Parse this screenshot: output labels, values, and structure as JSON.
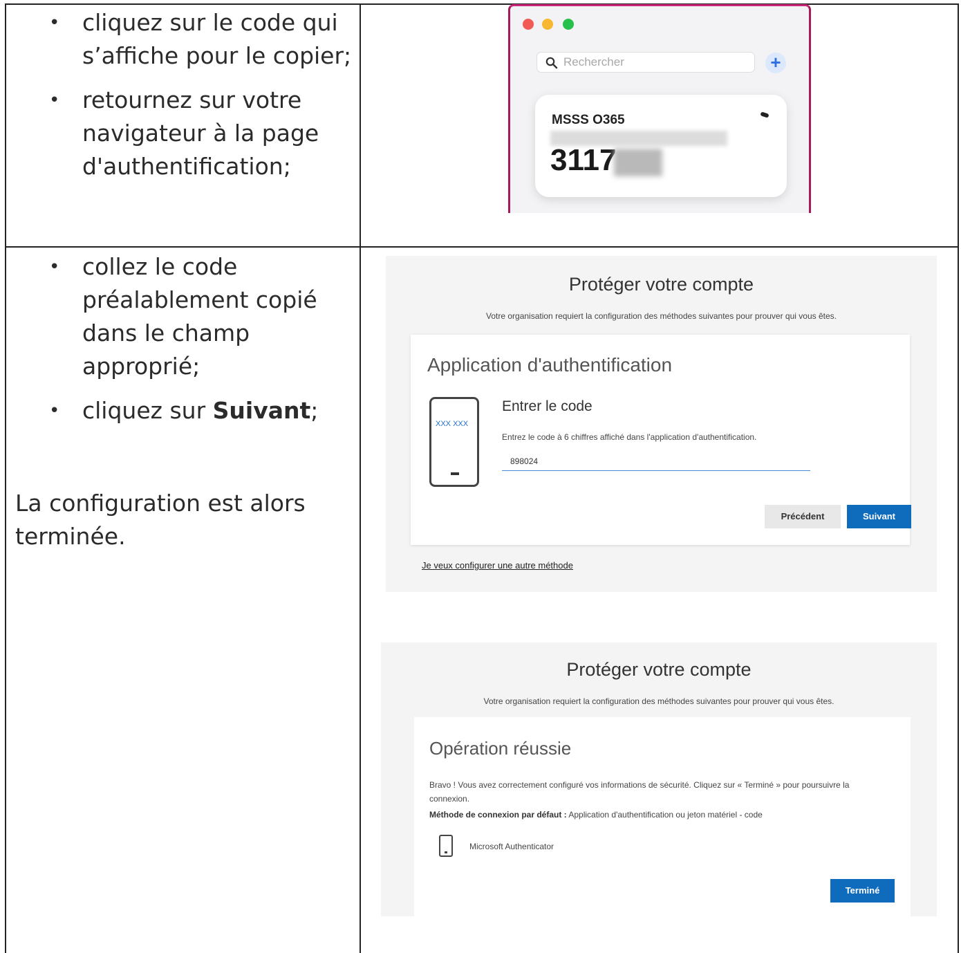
{
  "row1": {
    "bullets": [
      "cliquez sur le code qui s’affiche pour le copier;",
      "retournez sur votre navigateur à la page d'authentification;"
    ]
  },
  "authenticator_app": {
    "search_placeholder": "Rechercher",
    "plus_label": "+",
    "account_name": "MSSS O365",
    "code_visible": "3117"
  },
  "row2": {
    "bullet1": "collez le code préalablement copié dans le champ approprié;",
    "bullet2_prefix": "cliquez sur ",
    "bullet2_bold": "Suivant",
    "bullet2_suffix": ";",
    "paragraph": "La configuration est alors terminée."
  },
  "screen_code": {
    "title": "Protéger votre compte",
    "subtitle": "Votre organisation requiert la configuration des méthodes suivantes pour prouver qui vous êtes.",
    "card_title": "Application d'authentification",
    "phone_code": "XXX XXX",
    "section_title": "Entrer le code",
    "instruction": "Entrez le code à 6 chiffres affiché dans l'application d'authentification.",
    "code_value": "898024",
    "prev_button": "Précédent",
    "next_button": "Suivant",
    "other_method_link": "Je veux configurer une autre méthode"
  },
  "screen_success": {
    "title": "Protéger votre compte",
    "subtitle": "Votre organisation requiert la configuration des méthodes suivantes pour prouver qui vous êtes.",
    "card_title": "Opération réussie",
    "message": "Bravo ! Vous avez correctement configuré vos informations de sécurité. Cliquez sur « Terminé » pour poursuivre la connexion.",
    "default_method_label": "Méthode de connexion par défaut :",
    "default_method_value": " Application d'authentification ou jeton matériel - code",
    "method_name": "Microsoft Authenticator",
    "done_button": "Terminé"
  },
  "colors": {
    "ms_blue": "#0f6cbd",
    "app_border": "#a51a5a"
  }
}
